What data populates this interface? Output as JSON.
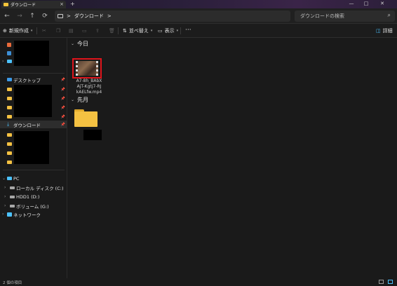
{
  "window": {
    "tab_title": "ダウンロード",
    "tab_close": "×",
    "new_tab": "+",
    "controls": [
      "—",
      "□",
      "✕"
    ]
  },
  "nav": {
    "back": "←",
    "forward": "→",
    "up": "↑",
    "refresh": "⟳",
    "breadcrumb_sep": ">",
    "breadcrumb": [
      "ダウンロード"
    ],
    "search_placeholder": "ダウンロードの検索"
  },
  "toolbar": {
    "new_label": "新規作成",
    "sort_label": "並べ替え",
    "view_label": "表示",
    "more_label": "···",
    "details_label": "詳細"
  },
  "sidebar": {
    "desktop": "デスクトップ",
    "downloads": "ダウンロード",
    "pc": "PC",
    "drives": [
      "ローカル ディスク (C:)",
      "HDD1 (D:)",
      "ボリューム (G:)"
    ],
    "network": "ネットワーク"
  },
  "content": {
    "groups": [
      {
        "name": "今日",
        "items": [
          {
            "name_lines": [
              "A7-8h_BAbX",
              "AjT-Kgtj7-RJ",
              "kAELfw.mp4"
            ],
            "type": "video"
          }
        ]
      },
      {
        "name": "先月",
        "items": [
          {
            "type": "folder"
          }
        ]
      }
    ]
  },
  "status": {
    "text": "2 個の項目"
  },
  "colors": {
    "accent": "#4cc2ff",
    "folder": "#f4c142",
    "highlight": "#e0141b"
  }
}
